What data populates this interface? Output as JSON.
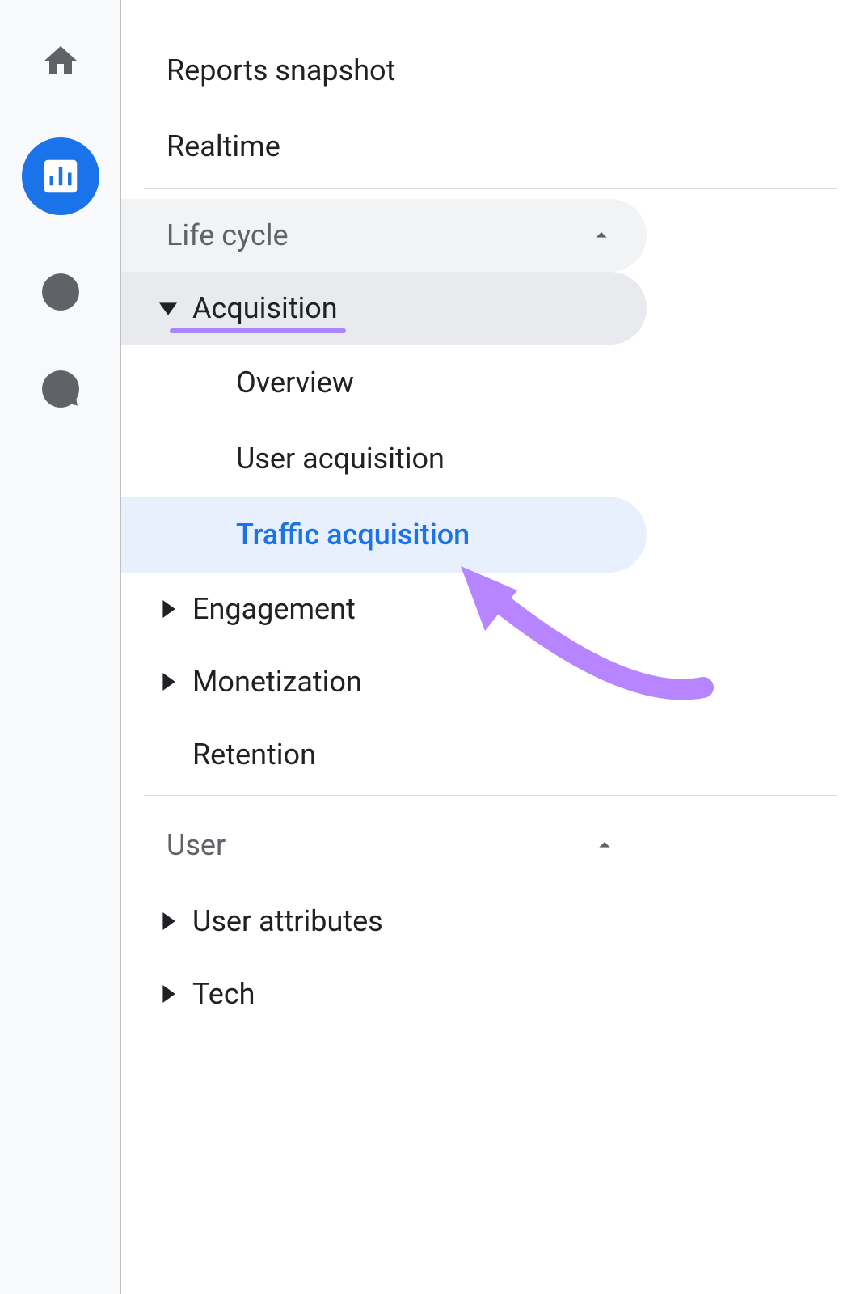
{
  "rail": {
    "icons": [
      "home",
      "reports",
      "explore",
      "advertising"
    ],
    "active_index": 1
  },
  "nav": {
    "top_items": [
      {
        "label": "Reports snapshot"
      },
      {
        "label": "Realtime"
      }
    ],
    "sections": [
      {
        "title": "Life cycle",
        "expanded": true,
        "items": [
          {
            "label": "Acquisition",
            "expanded": true,
            "highlighted": true,
            "children": [
              {
                "label": "Overview",
                "selected": false
              },
              {
                "label": "User acquisition",
                "selected": false
              },
              {
                "label": "Traffic acquisition",
                "selected": true
              }
            ]
          },
          {
            "label": "Engagement",
            "expanded": false
          },
          {
            "label": "Monetization",
            "expanded": false
          },
          {
            "label": "Retention",
            "expanded": false,
            "no_caret": true
          }
        ]
      },
      {
        "title": "User",
        "expanded": true,
        "items": [
          {
            "label": "User attributes",
            "expanded": false
          },
          {
            "label": "Tech",
            "expanded": false
          }
        ]
      }
    ]
  },
  "colors": {
    "accent": "#1a73e8",
    "highlight": "#a985ff",
    "selected_bg": "#e8f0fe"
  }
}
